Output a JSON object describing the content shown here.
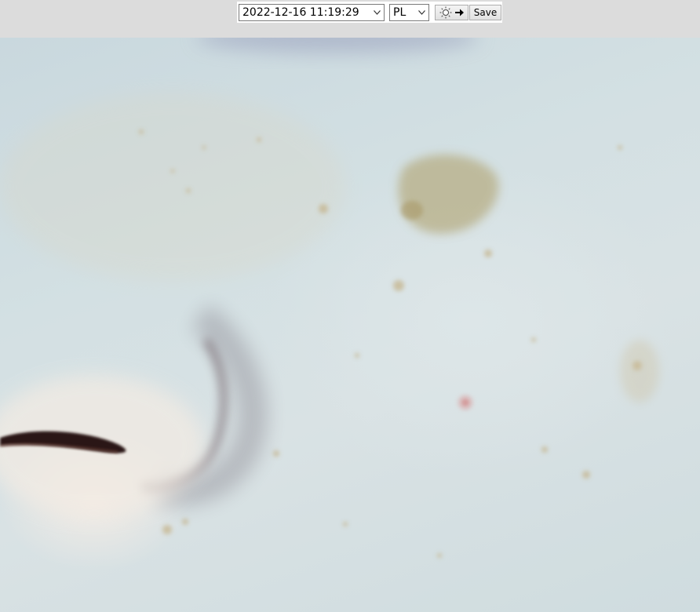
{
  "toolbar": {
    "capture_datetime": "2022-12-16 11:19:29",
    "mode": "PL",
    "save_label": "Save"
  },
  "viewer": {
    "image_alt": "skin close-up photo"
  }
}
